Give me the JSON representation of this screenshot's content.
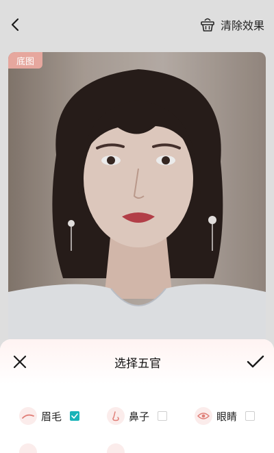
{
  "header": {
    "back_icon": "chevron-left-icon",
    "clear_icon": "basket-icon",
    "clear_label": "清除效果"
  },
  "photo": {
    "badge": "底图"
  },
  "sheet": {
    "title": "选择五官",
    "close_icon": "close-icon",
    "confirm_icon": "check-icon",
    "features": [
      {
        "label": "眉毛",
        "icon": "eyebrow-icon",
        "checked": true
      },
      {
        "label": "鼻子",
        "icon": "nose-icon",
        "checked": false
      },
      {
        "label": "眼睛",
        "icon": "eye-icon",
        "checked": false
      }
    ]
  },
  "colors": {
    "accent": "#19b3b8",
    "badge_bg": "#e6a79e",
    "icon_bg": "#fbeceb",
    "icon_stroke": "#e07f78"
  }
}
